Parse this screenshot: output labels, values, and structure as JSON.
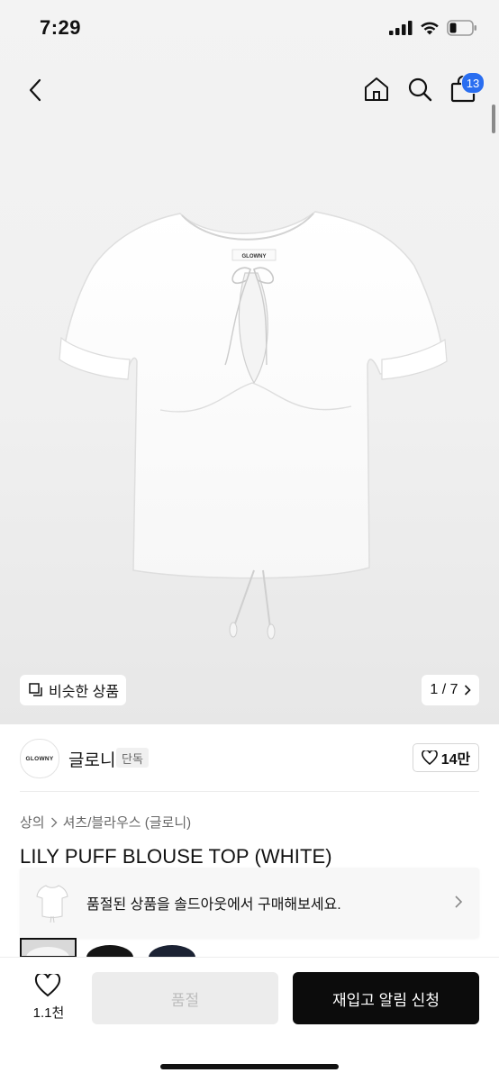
{
  "status_bar": {
    "time": "7:29"
  },
  "nav": {
    "cart_badge": "13"
  },
  "gallery": {
    "brand_label": "GLOWNY",
    "similar_label": "비슷한 상품",
    "page_counter": "1 / 7"
  },
  "brand": {
    "logo_text": "GLOWNY",
    "name": "글로니",
    "tag": "단독",
    "likes": "14만"
  },
  "breadcrumb": [
    "상의",
    "셔츠/블라우스 (글로니)"
  ],
  "product": {
    "title": "LILY PUFF BLOUSE TOP (WHITE)"
  },
  "banner": {
    "text": "품절된 상품을 솔드아웃에서 구매해보세요."
  },
  "bottom_bar": {
    "wish_count": "1.1천",
    "soldout_label": "품절",
    "restock_label": "재입고 알림 신청"
  },
  "colors": {
    "accent_badge": "#2a6ef0",
    "cta": "#0c0c0c"
  }
}
